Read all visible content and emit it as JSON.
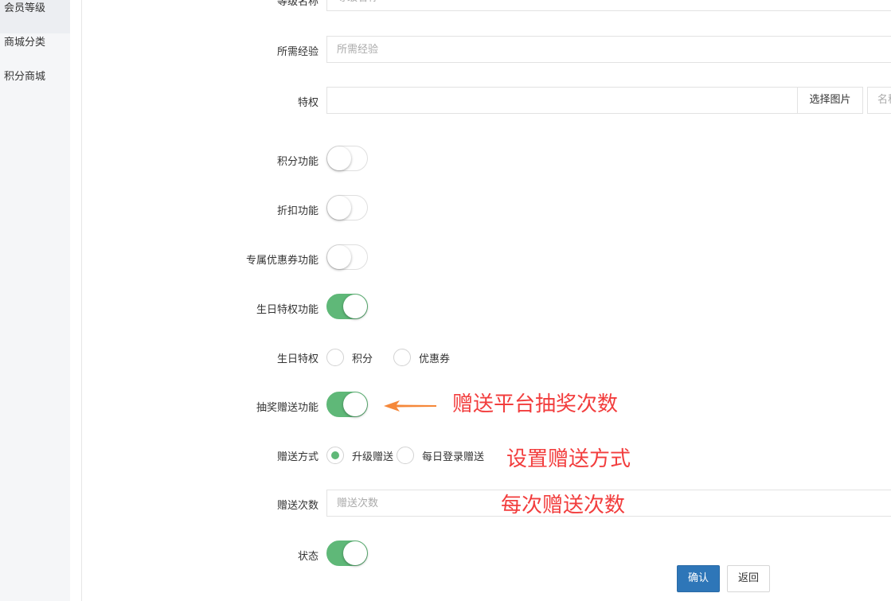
{
  "sidebar": {
    "items": [
      {
        "label": "会员等级",
        "active": true
      },
      {
        "label": "商城分类",
        "active": false
      },
      {
        "label": "积分商城",
        "active": false
      }
    ]
  },
  "form": {
    "level_name": {
      "label": "等级名称",
      "placeholder": "等级名称"
    },
    "required_exp": {
      "label": "所需经验",
      "placeholder": "所需经验"
    },
    "privilege": {
      "label": "特权",
      "select_button": "选择图片",
      "name_placeholder": "名称"
    },
    "points_feature": {
      "label": "积分功能",
      "on": false
    },
    "discount_feature": {
      "label": "折扣功能",
      "on": false
    },
    "coupon_feature": {
      "label": "专属优惠券功能",
      "on": false
    },
    "birthday_feature": {
      "label": "生日特权功能",
      "on": true
    },
    "birthday_privilege": {
      "label": "生日特权",
      "options": [
        {
          "label": "积分",
          "checked": false
        },
        {
          "label": "优惠券",
          "checked": false
        }
      ]
    },
    "lottery_gift_feature": {
      "label": "抽奖赠送功能",
      "on": true
    },
    "gift_method": {
      "label": "赠送方式",
      "options": [
        {
          "label": "升级赠送",
          "checked": true
        },
        {
          "label": "每日登录赠送",
          "checked": false
        }
      ]
    },
    "gift_count": {
      "label": "赠送次数",
      "placeholder": "赠送次数"
    },
    "status": {
      "label": "状态",
      "on": true
    }
  },
  "buttons": {
    "confirm": "确认",
    "back": "返回"
  },
  "annotations": {
    "lottery": "赠送平台抽奖次数",
    "method": "设置赠送方式",
    "count": "每次赠送次数"
  },
  "colors": {
    "toggle_on": "#5fb878",
    "primary_button": "#2e76b8",
    "annotation_text": "#f23d3d",
    "arrow": "#f5883a"
  }
}
